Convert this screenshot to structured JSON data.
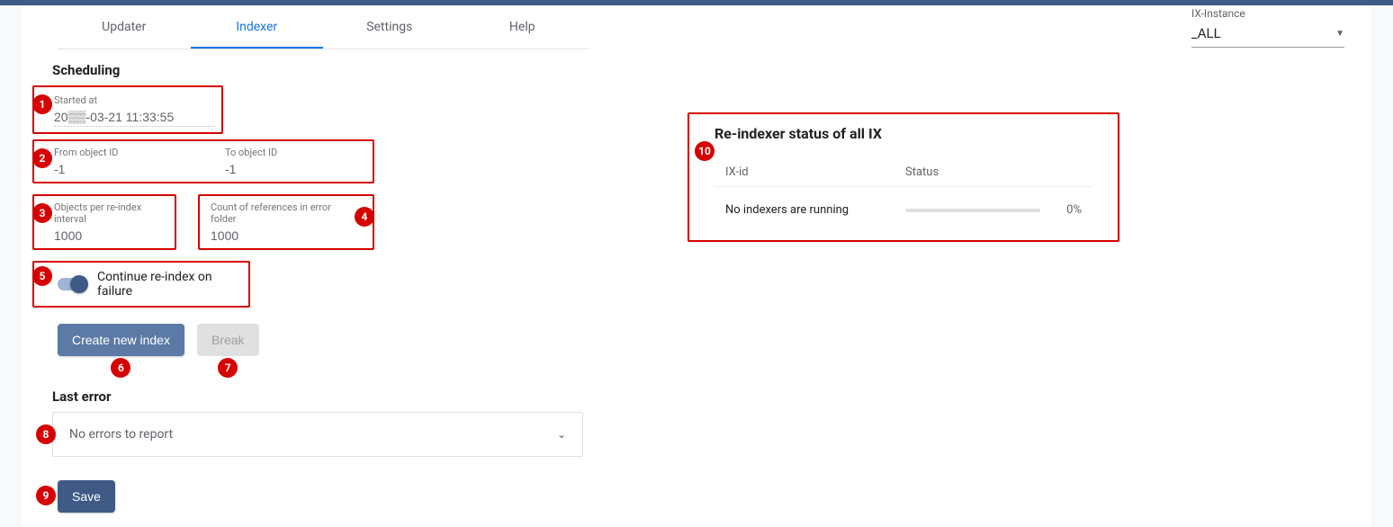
{
  "tabs": {
    "updater": "Updater",
    "indexer": "Indexer",
    "settings": "Settings",
    "help": "Help",
    "active": "indexer"
  },
  "instance": {
    "label": "IX-Instance",
    "value": "_ALL"
  },
  "annotations": {
    "b1": "1",
    "b2": "2",
    "b3": "3",
    "b4": "4",
    "b5": "5",
    "b6": "6",
    "b7": "7",
    "b8": "8",
    "b9": "9",
    "b10": "10"
  },
  "scheduling": {
    "title": "Scheduling",
    "started_label": "Started at",
    "started_value": "20▒▒-03-21 11:33:55",
    "from_label": "From object ID",
    "from_value": "-1",
    "to_label": "To object ID",
    "to_value": "-1",
    "interval_label": "Objects per re-index interval",
    "interval_value": "1000",
    "refcount_label": "Count of references in error folder",
    "refcount_value": "1000",
    "continue_label": "Continue re-index on failure"
  },
  "buttons": {
    "create": "Create new index",
    "break": "Break",
    "save": "Save"
  },
  "last_error": {
    "title": "Last error",
    "message": "No errors to report"
  },
  "status": {
    "title": "Re-indexer status of all IX",
    "col1": "IX-id",
    "col2": "Status",
    "message": "No indexers are running",
    "percent": "0%"
  }
}
